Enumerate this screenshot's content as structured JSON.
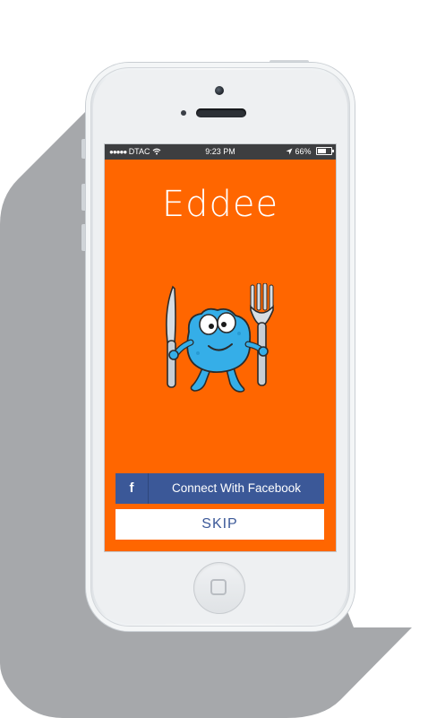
{
  "status_bar": {
    "signal_dots": "●●●●●",
    "carrier": "DTAC",
    "wifi_icon": "wifi-icon",
    "time": "9:23 PM",
    "location_icon": "location-arrow-icon",
    "battery_percent": "66%",
    "battery_level": 0.66
  },
  "app": {
    "title": "Eddee",
    "mascot_icon": "eddee-mascot-with-knife-and-fork-icon",
    "facebook_icon_glyph": "f",
    "facebook_button_label": "Connect With Facebook",
    "skip_button_label": "SKIP"
  },
  "colors": {
    "screen_background": "#ff6600",
    "facebook_blue": "#3b5898",
    "status_bar": "#3d3e40",
    "mascot_body": "#35aee8"
  }
}
